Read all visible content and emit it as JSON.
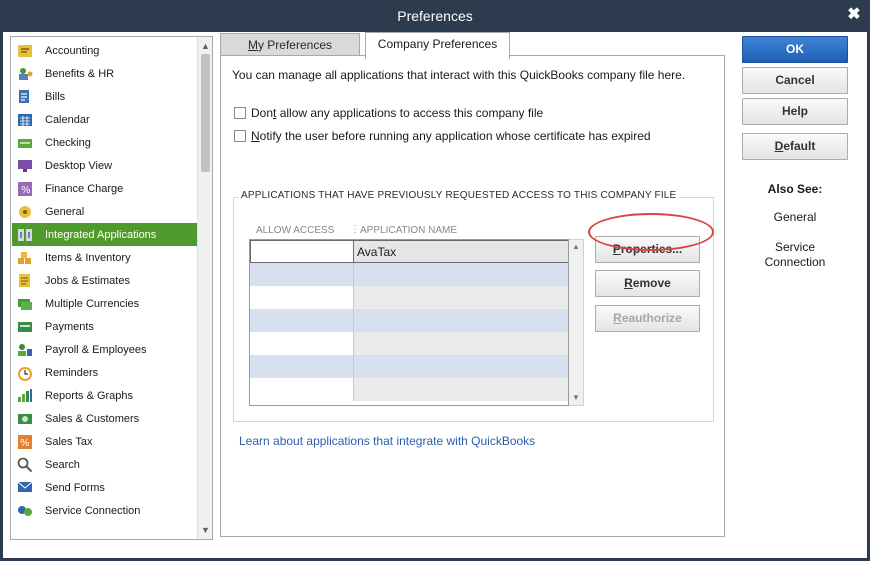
{
  "window": {
    "title": "Preferences",
    "close_glyph": "✖"
  },
  "sidebar": {
    "selected_index": 9,
    "items": [
      {
        "label": "Accounting",
        "icon": "accounting-icon"
      },
      {
        "label": "Benefits & HR",
        "icon": "benefits-icon"
      },
      {
        "label": "Bills",
        "icon": "bills-icon"
      },
      {
        "label": "Calendar",
        "icon": "calendar-icon"
      },
      {
        "label": "Checking",
        "icon": "checking-icon"
      },
      {
        "label": "Desktop View",
        "icon": "desktop-view-icon"
      },
      {
        "label": "Finance Charge",
        "icon": "finance-charge-icon"
      },
      {
        "label": "General",
        "icon": "general-icon"
      },
      {
        "label": "Integrated Applications",
        "icon": "integrated-apps-icon"
      },
      {
        "label": "Items & Inventory",
        "icon": "items-inventory-icon"
      },
      {
        "label": "Jobs & Estimates",
        "icon": "jobs-estimates-icon"
      },
      {
        "label": "Multiple Currencies",
        "icon": "currencies-icon"
      },
      {
        "label": "Payments",
        "icon": "payments-icon"
      },
      {
        "label": "Payroll & Employees",
        "icon": "payroll-icon"
      },
      {
        "label": "Reminders",
        "icon": "reminders-icon"
      },
      {
        "label": "Reports & Graphs",
        "icon": "reports-icon"
      },
      {
        "label": "Sales & Customers",
        "icon": "sales-customers-icon"
      },
      {
        "label": "Sales Tax",
        "icon": "sales-tax-icon"
      },
      {
        "label": "Search",
        "icon": "search-icon"
      },
      {
        "label": "Send Forms",
        "icon": "send-forms-icon"
      },
      {
        "label": "Service Connection",
        "icon": "service-connection-icon"
      }
    ]
  },
  "tabs": {
    "my_prefs_first": "M",
    "my_prefs_rest": "y Preferences",
    "company_prefs": "Company Preferences"
  },
  "content": {
    "intro": "You can manage all applications that interact with this QuickBooks company file here.",
    "check1_pre": "Don",
    "check1_ul": "t",
    "check1_post": " allow any applications to access this company file",
    "check2_pre": "",
    "check2_ul": "N",
    "check2_post": "otify the user before running any application whose certificate has expired",
    "group_title": "APPLICATIONS THAT HAVE PREVIOUSLY REQUESTED ACCESS TO THIS COMPANY FILE",
    "col_allow": "ALLOW ACCESS",
    "col_name": "APPLICATION NAME",
    "rows": [
      {
        "allow": "",
        "name": "AvaTax"
      }
    ],
    "learn_link": "Learn about applications that integrate with QuickBooks"
  },
  "buttons": {
    "properties_ul": "P",
    "properties_rest": "roperties...",
    "remove_ul": "R",
    "remove_rest": "emove",
    "reauthorize_ul": "R",
    "reauthorize_rest": "eauthorize",
    "ok": "OK",
    "cancel": "Cancel",
    "help": "Help",
    "default_ul": "D",
    "default_rest": "efault"
  },
  "also_see": {
    "title": "Also See:",
    "general": "General",
    "service_line1": "Service",
    "service_line2": "Connection"
  },
  "colors": {
    "titlebar": "#2d3b4f",
    "selected": "#4e9a2c",
    "primary_button": "#1f5fb5",
    "highlight_ring": "#d9463e",
    "link": "#2b5faf"
  }
}
